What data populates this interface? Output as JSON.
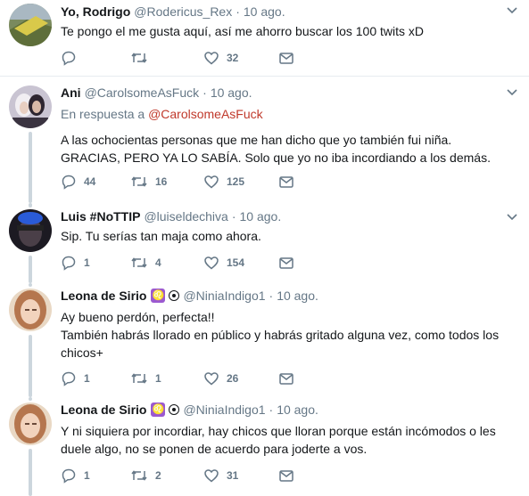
{
  "tweets": [
    {
      "name": "Yo, Rodrigo",
      "handle": "@Rodericus_Rex",
      "dot": "·",
      "time": "10 ago.",
      "text": "Te pongo el me gusta aquí, así me ahorro buscar los 100 twits xD",
      "replies": "",
      "retweets": "",
      "likes": "32"
    },
    {
      "name": "Ani",
      "handle": "@CarolsomeAsFuck",
      "dot": "·",
      "time": "10 ago.",
      "reply_label": "En respuesta a",
      "reply_mention": "@CarolsomeAsFuck",
      "text": "A las ochocientas personas que me han dicho que yo también fui niña. GRACIAS, PERO YA LO SABÍA. Solo que yo no iba incordiando a los demás.",
      "replies": "44",
      "retweets": "16",
      "likes": "125"
    },
    {
      "name": "Luis #NoTTIP",
      "handle": "@luiseldechiva",
      "dot": "·",
      "time": "10 ago.",
      "text": "Sip. Tu serías tan maja como ahora.",
      "replies": "1",
      "retweets": "4",
      "likes": "154"
    },
    {
      "name": "Leona de Sirio",
      "badge": "♌",
      "handle": "@NiniaIndigo1",
      "dot": "·",
      "time": "10 ago.",
      "text_line1": "Ay bueno perdón, perfecta!!",
      "text_line2": "También habrás llorado en público y habrás gritado alguna vez, como todos los chicos+",
      "replies": "1",
      "retweets": "1",
      "likes": "26"
    },
    {
      "name": "Leona de Sirio",
      "badge": "♌",
      "handle": "@NiniaIndigo1",
      "dot": "·",
      "time": "10 ago.",
      "text": "Y ni siquiera por incordiar, hay chicos que lloran porque están incómodos o les duele algo, no se ponen de acuerdo para joderte a vos.",
      "replies": "1",
      "retweets": "2",
      "likes": "31"
    }
  ],
  "colors": {
    "link": "#1da1f2",
    "mention": "#c0392b",
    "muted": "#657786",
    "separator": "#e6ecf0",
    "thread": "#ccd6dd"
  }
}
